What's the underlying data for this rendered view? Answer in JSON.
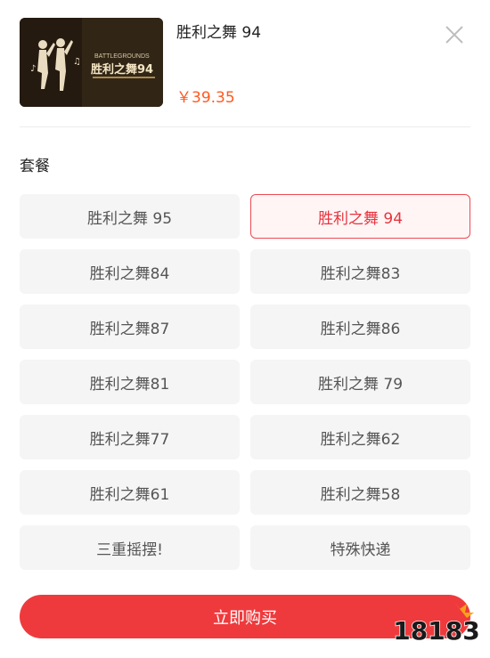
{
  "product": {
    "title": "胜利之舞 94",
    "price": "￥39.35",
    "thumbnail_alt_text": "胜利之舞94",
    "thumbnail_small_text": "BATTLEGROUNDS"
  },
  "section": {
    "label": "套餐"
  },
  "options": [
    {
      "label": "胜利之舞 95",
      "selected": false
    },
    {
      "label": "胜利之舞 94",
      "selected": true
    },
    {
      "label": "胜利之舞84",
      "selected": false
    },
    {
      "label": "胜利之舞83",
      "selected": false
    },
    {
      "label": "胜利之舞87",
      "selected": false
    },
    {
      "label": "胜利之舞86",
      "selected": false
    },
    {
      "label": "胜利之舞81",
      "selected": false
    },
    {
      "label": "胜利之舞 79",
      "selected": false
    },
    {
      "label": "胜利之舞77",
      "selected": false
    },
    {
      "label": "胜利之舞62",
      "selected": false
    },
    {
      "label": "胜利之舞61",
      "selected": false
    },
    {
      "label": "胜利之舞58",
      "selected": false
    },
    {
      "label": "三重摇摆!",
      "selected": false
    },
    {
      "label": "特殊快递",
      "selected": false
    }
  ],
  "actions": {
    "buy_label": "立即购买"
  },
  "watermark": {
    "text": "18183"
  },
  "colors": {
    "accent": "#ef3a3d",
    "price": "#ff5a1f",
    "selected_text": "#e8343e"
  },
  "icons": {
    "close": "close-icon"
  }
}
